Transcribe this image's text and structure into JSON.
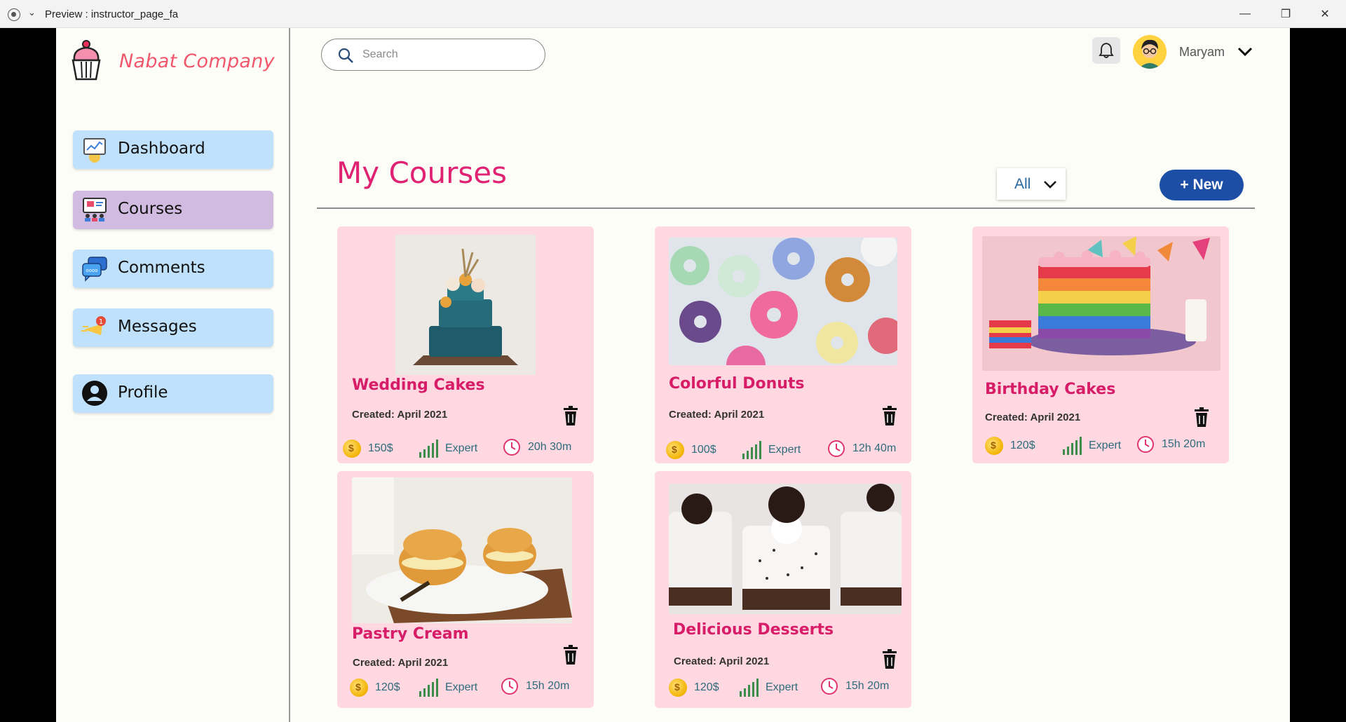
{
  "window": {
    "title": "Preview : instructor_page_fa",
    "controls": {
      "minimize": "—",
      "maximize": "❐",
      "close": "✕"
    }
  },
  "brand": {
    "name": "Nabat Company"
  },
  "sidebar": {
    "items": [
      {
        "label": "Dashboard",
        "icon": "dashboard-icon"
      },
      {
        "label": "Courses",
        "icon": "courses-icon",
        "active": true
      },
      {
        "label": "Comments",
        "icon": "comments-icon"
      },
      {
        "label": "Messages",
        "icon": "messages-icon"
      },
      {
        "label": "Profile",
        "icon": "profile-icon"
      }
    ]
  },
  "header": {
    "search_placeholder": "Search",
    "user_name": "Maryam"
  },
  "main": {
    "title": "My Courses",
    "filter": "All",
    "new_button": "+ New"
  },
  "courses": [
    {
      "title": "Wedding Cakes",
      "created": "Created: April 2021",
      "price": "150$",
      "level": "Expert",
      "duration": "20h 30m",
      "image": "wedding-cake-image"
    },
    {
      "title": "Colorful Donuts",
      "created": "Created: April 2021",
      "price": "100$",
      "level": "Expert",
      "duration": "12h 40m",
      "image": "donuts-image"
    },
    {
      "title": "Birthday Cakes",
      "created": "Created: April 2021",
      "price": "120$",
      "level": "Expert",
      "duration": "15h 20m",
      "image": "birthday-cake-image"
    },
    {
      "title": "Pastry Cream",
      "created": "Created: April 2021",
      "price": "120$",
      "level": "Expert",
      "duration": "15h 20m",
      "image": "pastry-cream-image"
    },
    {
      "title": "Delicious Desserts",
      "created": "Created: April 2021",
      "price": "120$",
      "level": "Expert",
      "duration": "15h 20m",
      "image": "desserts-image"
    }
  ],
  "colors": {
    "accent_pink": "#e02273",
    "card_bg": "#ffd8e2",
    "nav_bg": "#bfe1fc",
    "nav_active_bg": "#d2bbe0",
    "new_button_bg": "#1d4ea6",
    "logo_text": "#f0566c"
  }
}
